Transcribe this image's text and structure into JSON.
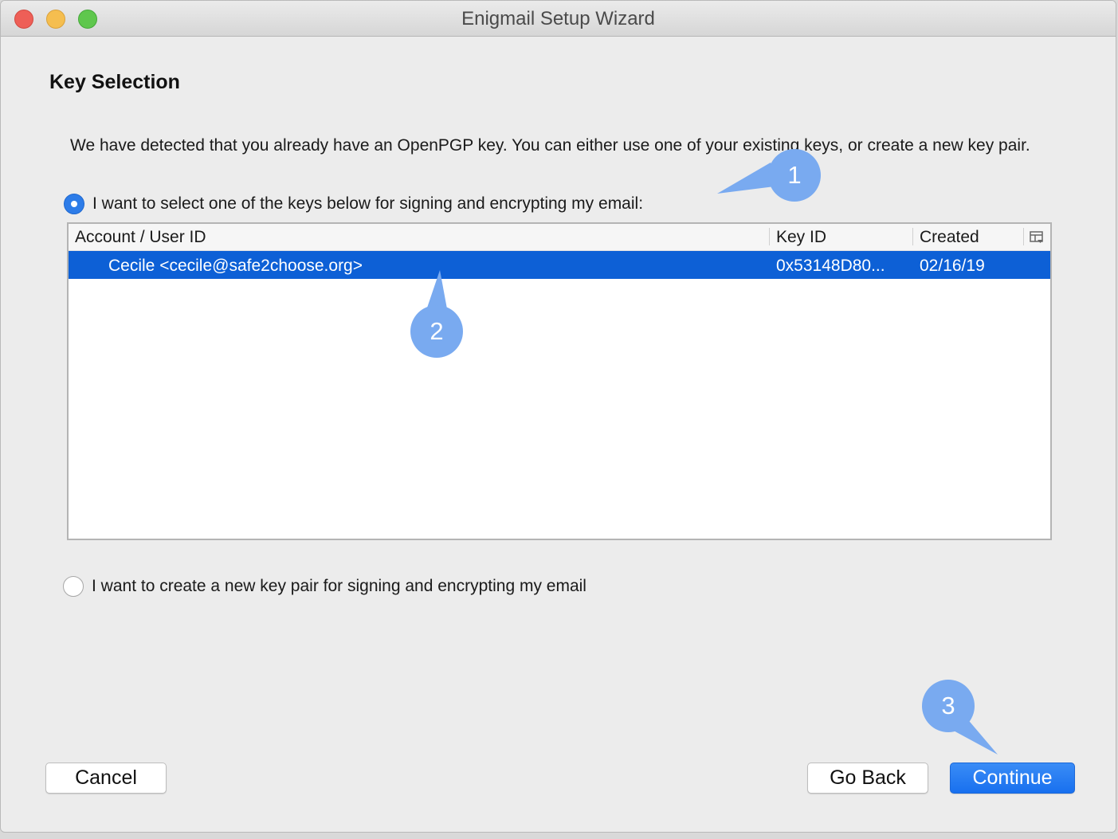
{
  "window": {
    "title": "Enigmail Setup Wizard",
    "buttons": [
      "close",
      "minimize",
      "zoom"
    ]
  },
  "page": {
    "heading": "Key Selection",
    "intro": "We have detected that you already have an OpenPGP key. You can either use one of your existing keys, or create a new key pair."
  },
  "options": {
    "select_existing": {
      "label": "I want to select one of the keys below for signing and encrypting my email:",
      "selected": true
    },
    "create_new": {
      "label": "I want to create a new key pair for signing and encrypting my email",
      "selected": false
    }
  },
  "key_table": {
    "columns": [
      "Account / User ID",
      "Key ID",
      "Created"
    ],
    "column_picker_icon": "column-picker-icon",
    "rows": [
      {
        "user_id": "Cecile <cecile@safe2choose.org>",
        "key_id": "0x53148D80...",
        "created": "02/16/19",
        "selected": true
      }
    ]
  },
  "buttons": {
    "cancel": "Cancel",
    "go_back": "Go Back",
    "continue": "Continue"
  },
  "callouts": [
    "1",
    "2",
    "3"
  ],
  "colors": {
    "selection": "#0d60d6",
    "primary_button": "#1870ef",
    "callout": "#79aaf0"
  }
}
